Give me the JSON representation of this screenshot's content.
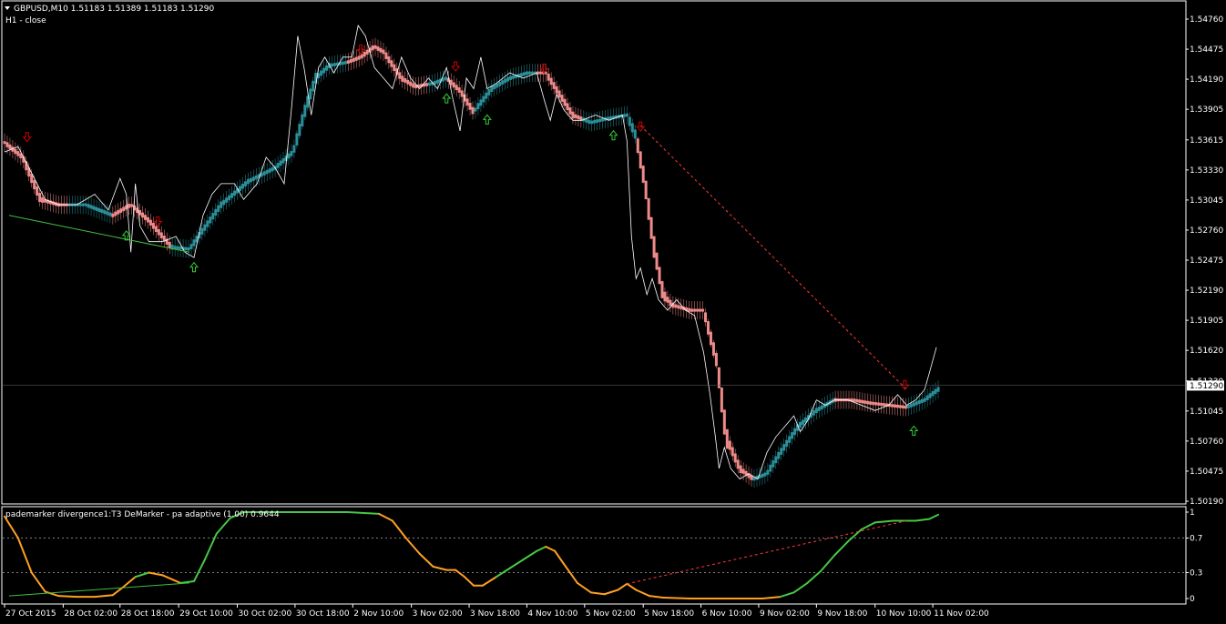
{
  "header": {
    "symbol_line": "GBPUSD,M10  1.51183 1.51389 1.51183 1.51290",
    "overlay_label": "H1 - close"
  },
  "indicator": {
    "label": "pademarker divergence1:T3 DeMarker - pa adaptive (1.00) 0.9644",
    "levels": [
      0.3,
      0.7
    ],
    "ticks": [
      "1",
      "0.7",
      "0.3",
      "0"
    ]
  },
  "current_price": "1.51290",
  "colors": {
    "background": "#000000",
    "bull": "#2a8f99",
    "bear": "#f08a8a",
    "close_line": "#ffffff",
    "indicator_bull": "#46c846",
    "indicator_bear": "#ffa020",
    "div_line_bull": "#3fbf3f",
    "div_line_bear": "#ff3a3a",
    "arrow_up": "#33cc33",
    "arrow_down": "#cc0000",
    "grid": "#ffffff",
    "price_box_bg": "#ffffff",
    "price_box_text": "#000000"
  },
  "chart_data": [
    {
      "type": "line",
      "title": "GBPUSD,M10",
      "yticks": [
        "1.54760",
        "1.54475",
        "1.54190",
        "1.53905",
        "1.53615",
        "1.53330",
        "1.53045",
        "1.52760",
        "1.52475",
        "1.52190",
        "1.51905",
        "1.51620",
        "1.51330",
        "1.51045",
        "1.50760",
        "1.50475",
        "1.50190"
      ],
      "ylim": [
        1.5019,
        1.5476
      ],
      "xlim": [
        0,
        1040
      ],
      "xticks": [
        {
          "label": "27 Oct 2015",
          "x": 0
        },
        {
          "label": "28 Oct 02:00",
          "x": 65
        },
        {
          "label": "28 Oct 18:00",
          "x": 128
        },
        {
          "label": "29 Oct 10:00",
          "x": 193
        },
        {
          "label": "30 Oct 02:00",
          "x": 258
        },
        {
          "label": "30 Oct 18:00",
          "x": 322
        },
        {
          "label": "2 Nov 10:00",
          "x": 386
        },
        {
          "label": "3 Nov 02:00",
          "x": 451
        },
        {
          "label": "3 Nov 18:00",
          "x": 515
        },
        {
          "label": "4 Nov 10:00",
          "x": 579
        },
        {
          "label": "5 Nov 02:00",
          "x": 643
        },
        {
          "label": "5 Nov 18:00",
          "x": 708
        },
        {
          "label": "6 Nov 10:00",
          "x": 772
        },
        {
          "label": "9 Nov 02:00",
          "x": 836
        },
        {
          "label": "9 Nov 18:00",
          "x": 900
        },
        {
          "label": "10 Nov 10:00",
          "x": 965
        },
        {
          "label": "11 Nov 02:00",
          "x": 1029
        }
      ],
      "smooth_series": [
        [
          0,
          1.5359
        ],
        [
          20,
          1.5345
        ],
        [
          40,
          1.5305
        ],
        [
          60,
          1.53
        ],
        [
          90,
          1.53
        ],
        [
          120,
          1.529
        ],
        [
          140,
          1.53
        ],
        [
          160,
          1.5285
        ],
        [
          185,
          1.526
        ],
        [
          205,
          1.5258
        ],
        [
          215,
          1.527
        ],
        [
          240,
          1.53
        ],
        [
          270,
          1.5322
        ],
        [
          300,
          1.5335
        ],
        [
          320,
          1.535
        ],
        [
          335,
          1.5395
        ],
        [
          345,
          1.542
        ],
        [
          360,
          1.5432
        ],
        [
          380,
          1.5435
        ],
        [
          395,
          1.544
        ],
        [
          410,
          1.545
        ],
        [
          420,
          1.5445
        ],
        [
          440,
          1.542
        ],
        [
          455,
          1.5412
        ],
        [
          475,
          1.5415
        ],
        [
          490,
          1.542
        ],
        [
          505,
          1.5408
        ],
        [
          520,
          1.5388
        ],
        [
          540,
          1.541
        ],
        [
          560,
          1.542
        ],
        [
          580,
          1.5425
        ],
        [
          600,
          1.5425
        ],
        [
          615,
          1.5405
        ],
        [
          630,
          1.5385
        ],
        [
          650,
          1.5378
        ],
        [
          670,
          1.5382
        ],
        [
          690,
          1.5385
        ],
        [
          700,
          1.5365
        ],
        [
          710,
          1.532
        ],
        [
          720,
          1.526
        ],
        [
          730,
          1.5215
        ],
        [
          740,
          1.5205
        ],
        [
          760,
          1.52
        ],
        [
          775,
          1.52
        ],
        [
          790,
          1.515
        ],
        [
          800,
          1.508
        ],
        [
          815,
          1.505
        ],
        [
          830,
          1.504
        ],
        [
          845,
          1.5045
        ],
        [
          860,
          1.5065
        ],
        [
          880,
          1.509
        ],
        [
          900,
          1.5105
        ],
        [
          920,
          1.5115
        ],
        [
          940,
          1.5115
        ],
        [
          960,
          1.5112
        ],
        [
          980,
          1.511
        ],
        [
          1000,
          1.5108
        ],
        [
          1020,
          1.5115
        ],
        [
          1035,
          1.5125
        ]
      ],
      "close_series": [
        [
          0,
          1.535
        ],
        [
          15,
          1.5355
        ],
        [
          30,
          1.533
        ],
        [
          45,
          1.5305
        ],
        [
          60,
          1.53
        ],
        [
          80,
          1.53
        ],
        [
          100,
          1.531
        ],
        [
          115,
          1.5295
        ],
        [
          128,
          1.5325
        ],
        [
          135,
          1.531
        ],
        [
          140,
          1.5255
        ],
        [
          145,
          1.532
        ],
        [
          150,
          1.528
        ],
        [
          160,
          1.5265
        ],
        [
          175,
          1.5265
        ],
        [
          190,
          1.527
        ],
        [
          200,
          1.5255
        ],
        [
          210,
          1.525
        ],
        [
          220,
          1.529
        ],
        [
          230,
          1.531
        ],
        [
          240,
          1.532
        ],
        [
          255,
          1.532
        ],
        [
          265,
          1.5305
        ],
        [
          280,
          1.532
        ],
        [
          290,
          1.5345
        ],
        [
          300,
          1.5335
        ],
        [
          310,
          1.532
        ],
        [
          318,
          1.539
        ],
        [
          325,
          1.546
        ],
        [
          332,
          1.543
        ],
        [
          340,
          1.5385
        ],
        [
          348,
          1.543
        ],
        [
          355,
          1.544
        ],
        [
          365,
          1.5425
        ],
        [
          375,
          1.544
        ],
        [
          385,
          1.544
        ],
        [
          392,
          1.547
        ],
        [
          400,
          1.546
        ],
        [
          410,
          1.543
        ],
        [
          420,
          1.542
        ],
        [
          430,
          1.541
        ],
        [
          440,
          1.544
        ],
        [
          450,
          1.542
        ],
        [
          460,
          1.541
        ],
        [
          470,
          1.542
        ],
        [
          480,
          1.541
        ],
        [
          490,
          1.543
        ],
        [
          497,
          1.54
        ],
        [
          505,
          1.537
        ],
        [
          512,
          1.542
        ],
        [
          520,
          1.541
        ],
        [
          528,
          1.544
        ],
        [
          535,
          1.541
        ],
        [
          545,
          1.5415
        ],
        [
          560,
          1.5425
        ],
        [
          575,
          1.542
        ],
        [
          590,
          1.5425
        ],
        [
          598,
          1.54
        ],
        [
          605,
          1.538
        ],
        [
          612,
          1.5405
        ],
        [
          620,
          1.539
        ],
        [
          630,
          1.538
        ],
        [
          640,
          1.538
        ],
        [
          655,
          1.5385
        ],
        [
          670,
          1.538
        ],
        [
          685,
          1.5385
        ],
        [
          690,
          1.536
        ],
        [
          695,
          1.527
        ],
        [
          700,
          1.523
        ],
        [
          705,
          1.524
        ],
        [
          712,
          1.5215
        ],
        [
          718,
          1.523
        ],
        [
          725,
          1.521
        ],
        [
          735,
          1.52
        ],
        [
          745,
          1.521
        ],
        [
          755,
          1.52
        ],
        [
          765,
          1.5195
        ],
        [
          775,
          1.516
        ],
        [
          782,
          1.512
        ],
        [
          788,
          1.508
        ],
        [
          792,
          1.505
        ],
        [
          798,
          1.507
        ],
        [
          805,
          1.505
        ],
        [
          815,
          1.504
        ],
        [
          825,
          1.5045
        ],
        [
          835,
          1.504
        ],
        [
          845,
          1.5065
        ],
        [
          855,
          1.508
        ],
        [
          865,
          1.509
        ],
        [
          875,
          1.51
        ],
        [
          882,
          1.5085
        ],
        [
          890,
          1.5095
        ],
        [
          900,
          1.5115
        ],
        [
          910,
          1.511
        ],
        [
          920,
          1.5115
        ],
        [
          935,
          1.5115
        ],
        [
          950,
          1.511
        ],
        [
          965,
          1.5105
        ],
        [
          980,
          1.511
        ],
        [
          990,
          1.512
        ],
        [
          1000,
          1.511
        ],
        [
          1010,
          1.5115
        ],
        [
          1020,
          1.5125
        ],
        [
          1025,
          1.514
        ],
        [
          1033,
          1.5165
        ]
      ],
      "bear_segments": [
        [
          0,
          70
        ],
        [
          120,
          185
        ],
        [
          380,
          470
        ],
        [
          490,
          520
        ],
        [
          590,
          640
        ],
        [
          700,
          830
        ],
        [
          920,
          1000
        ]
      ],
      "up_arrows": [
        [
          135,
          1.527
        ],
        [
          210,
          1.524
        ],
        [
          490,
          1.54
        ],
        [
          535,
          1.538
        ],
        [
          675,
          1.5365
        ],
        [
          1008,
          1.5085
        ]
      ],
      "down_arrows": [
        [
          25,
          1.5365
        ],
        [
          170,
          1.5285
        ],
        [
          395,
          1.5448
        ],
        [
          500,
          1.5432
        ],
        [
          598,
          1.543
        ],
        [
          705,
          1.5375
        ],
        [
          998,
          1.513
        ]
      ],
      "divergence_lines": [
        {
          "color": "bull",
          "dash": false,
          "from": [
            5,
            1.529
          ],
          "to": [
            205,
            1.5255
          ]
        },
        {
          "color": "bear",
          "dash": true,
          "from": [
            705,
            1.5375
          ],
          "to": [
            1000,
            1.5125
          ]
        }
      ]
    },
    {
      "type": "line",
      "title": "pademarker divergence1:T3 DeMarker - pa adaptive (1.00) 0.9644",
      "ylim": [
        0,
        1
      ],
      "series": [
        {
          "values": [
            [
              0,
              0.95
            ],
            [
              15,
              0.7
            ],
            [
              30,
              0.3
            ],
            [
              45,
              0.08
            ],
            [
              60,
              0.03
            ],
            [
              80,
              0.02
            ],
            [
              100,
              0.02
            ],
            [
              120,
              0.04
            ],
            [
              130,
              0.12
            ],
            [
              145,
              0.25
            ],
            [
              160,
              0.3
            ],
            [
              175,
              0.27
            ],
            [
              195,
              0.18
            ],
            [
              210,
              0.2
            ],
            [
              222,
              0.45
            ],
            [
              235,
              0.75
            ],
            [
              250,
              0.93
            ],
            [
              265,
              1.0
            ],
            [
              300,
              1.0
            ],
            [
              380,
              1.0
            ],
            [
              415,
              0.98
            ],
            [
              430,
              0.9
            ],
            [
              445,
              0.7
            ],
            [
              460,
              0.52
            ],
            [
              475,
              0.37
            ],
            [
              490,
              0.33
            ],
            [
              500,
              0.33
            ],
            [
              510,
              0.25
            ],
            [
              520,
              0.15
            ],
            [
              530,
              0.15
            ],
            [
              545,
              0.25
            ],
            [
              560,
              0.35
            ],
            [
              575,
              0.45
            ],
            [
              590,
              0.55
            ],
            [
              600,
              0.6
            ],
            [
              610,
              0.55
            ],
            [
              620,
              0.4
            ],
            [
              635,
              0.18
            ],
            [
              650,
              0.07
            ],
            [
              665,
              0.05
            ],
            [
              680,
              0.1
            ],
            [
              690,
              0.17
            ],
            [
              700,
              0.1
            ],
            [
              715,
              0.03
            ],
            [
              730,
              0.01
            ],
            [
              760,
              0.0
            ],
            [
              800,
              0.0
            ],
            [
              840,
              0.0
            ],
            [
              860,
              0.02
            ],
            [
              875,
              0.07
            ],
            [
              890,
              0.18
            ],
            [
              905,
              0.32
            ],
            [
              920,
              0.5
            ],
            [
              935,
              0.66
            ],
            [
              950,
              0.8
            ],
            [
              965,
              0.88
            ],
            [
              985,
              0.9
            ],
            [
              1010,
              0.9
            ],
            [
              1025,
              0.92
            ],
            [
              1035,
              0.97
            ]
          ]
        }
      ],
      "bear_segments": [
        [
          0,
          140
        ],
        [
          160,
          200
        ],
        [
          415,
          540
        ],
        [
          600,
          700
        ],
        [
          705,
          860
        ]
      ]
    }
  ]
}
